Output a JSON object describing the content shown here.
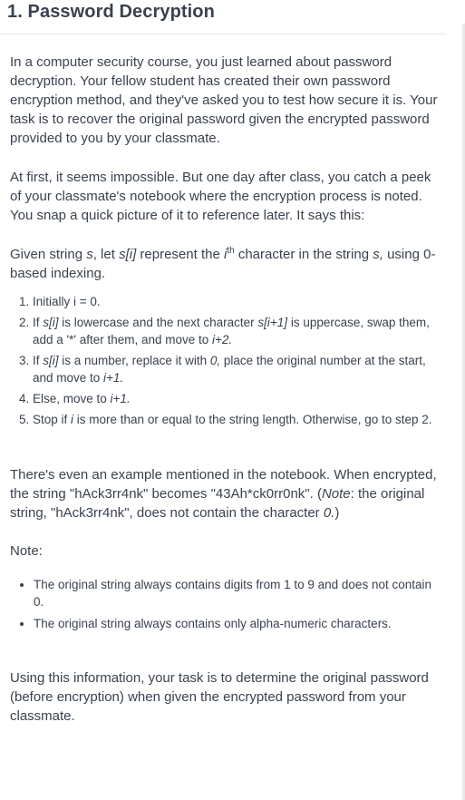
{
  "title": "1. Password Decryption",
  "intro": "In a computer security course, you just learned about password decryption. Your fellow student has created their own password encryption method, and they've asked you to test how secure it is. Your task is to recover the original password given the encrypted password provided to you by your classmate.",
  "story": "At first, it seems impossible. But one day after class, you catch a peek of your classmate's notebook where the encryption process is noted. You snap a quick picture of it to reference later. It says this:",
  "given": {
    "t1": "Given string ",
    "s": "s",
    "t2": ", let ",
    "si": "s[i]",
    "t3": " represent the ",
    "i": "i",
    "th": "th",
    "t4": " character in the string ",
    "s2": "s,",
    "t5": " using 0-based indexing."
  },
  "steps": {
    "s1": "Initially i = 0.",
    "s2a": "If ",
    "s2b": "s[i]",
    "s2c": " is lowercase and the next character ",
    "s2d": "s[i+1]",
    "s2e": " is uppercase, swap them, add a '*' after them, and move to ",
    "s2f": "i+2.",
    "s3a": "If ",
    "s3b": "s[i]",
    "s3c": " is a number, replace it with ",
    "s3d": "0,",
    "s3e": " place the original number at the start, and move to ",
    "s3f": "i+1.",
    "s4a": "Else, move to ",
    "s4b": "i+1.",
    "s5a": "Stop if ",
    "s5b": "i",
    "s5c": " is more than or equal to the string length. Otherwise, go to step 2."
  },
  "example": {
    "t1": "There's even an example mentioned in the notebook. When encrypted, the string \"hAck3rr4nk\" becomes \"43Ah*ck0rr0nk\". (",
    "note": "Note",
    "t2": ": the original string, \"hAck3rr4nk\", does not contain the character ",
    "zero": "0.",
    "t3": ")"
  },
  "note_label": "Note:",
  "notes": [
    "The original string always contains digits from 1 to 9 and does not contain 0.",
    "The original string always contains only alpha-numeric characters."
  ],
  "task": "Using this information, your task is to determine the original password (before encryption) when given the encrypted password from your classmate."
}
